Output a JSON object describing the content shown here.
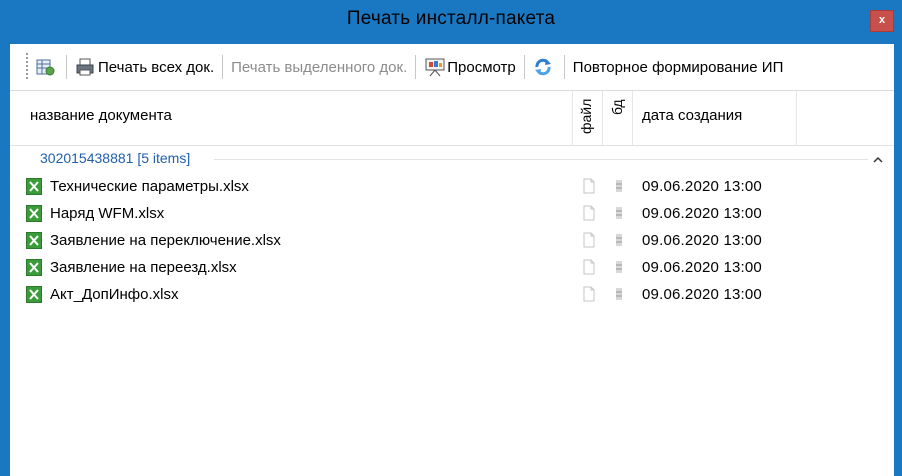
{
  "window": {
    "title": "Печать инсталл-пакета",
    "close_label": "x"
  },
  "toolbar": {
    "print_all_label": "Печать всех док.",
    "print_selected_label": "Печать выделенного док.",
    "preview_label": "Просмотр",
    "regenerate_label": "Повторное формирование ИП"
  },
  "grid": {
    "columns": {
      "name": "название документа",
      "file": "файл",
      "db": "бд",
      "date": "дата создания"
    },
    "group_label": "302015438881 [5 items]",
    "rows": [
      {
        "name": "Технические параметры.xlsx",
        "date": "09.06.2020 13:00"
      },
      {
        "name": "Наряд WFM.xlsx",
        "date": "09.06.2020 13:00"
      },
      {
        "name": "Заявление на переключение.xlsx",
        "date": "09.06.2020 13:00"
      },
      {
        "name": "Заявление на переезд.xlsx",
        "date": "09.06.2020 13:00"
      },
      {
        "name": "Акт_ДопИнфо.xlsx",
        "date": "09.06.2020 13:00"
      }
    ]
  },
  "colors": {
    "frame": "#1a78c2",
    "group_text": "#1f5faa",
    "excel_green": "#3b9b3b",
    "close_red": "#c7504b"
  }
}
